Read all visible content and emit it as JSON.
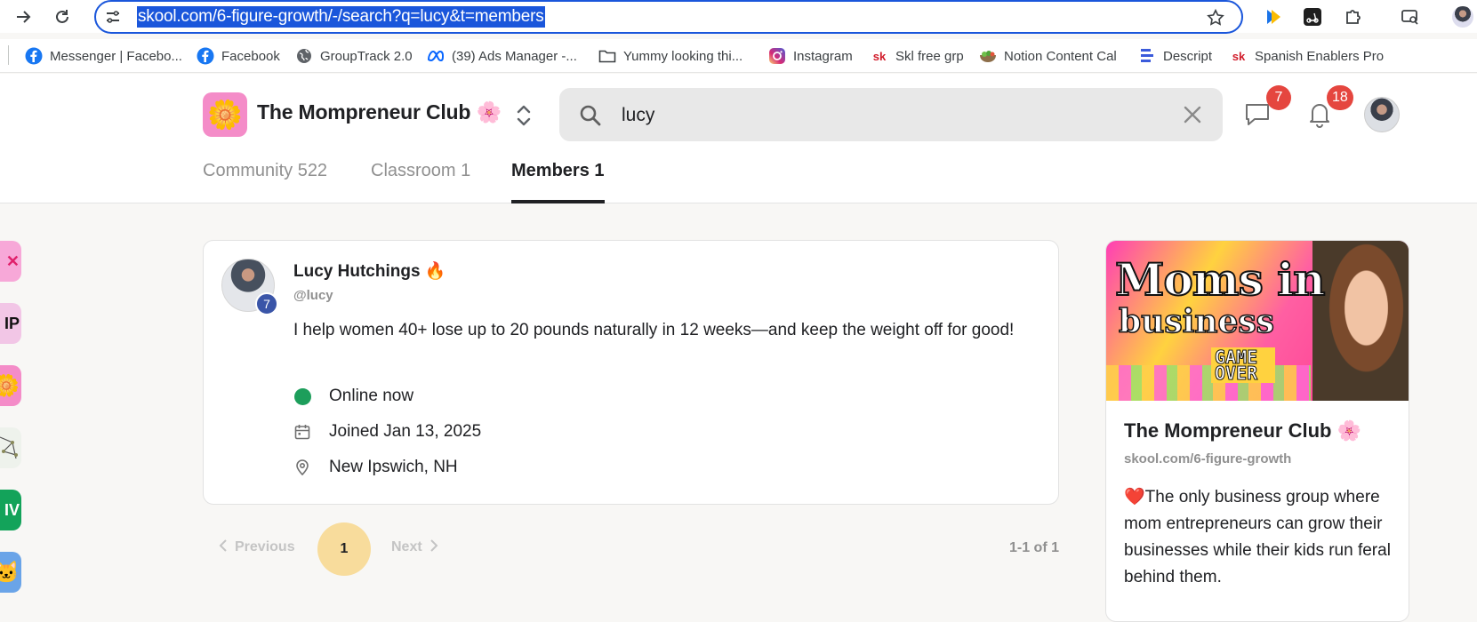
{
  "browser": {
    "url": "skool.com/6-figure-growth/-/search?q=lucy&t=members",
    "bookmarks": [
      {
        "label": "Messenger | Facebo...",
        "icon": "facebook-icon"
      },
      {
        "label": "Facebook",
        "icon": "facebook-icon"
      },
      {
        "label": "GroupTrack 2.0",
        "icon": "globe-icon"
      },
      {
        "label": "(39) Ads Manager -...",
        "icon": "meta-icon"
      },
      {
        "label": "Yummy looking thi...",
        "icon": "folder-icon"
      },
      {
        "label": "Instagram",
        "icon": "instagram-icon"
      },
      {
        "label": "Skl free grp",
        "icon": "skool-icon"
      },
      {
        "label": "Notion Content Cal",
        "icon": "salad-icon"
      },
      {
        "label": "Descript",
        "icon": "descript-icon"
      },
      {
        "label": "Spanish Enablers Pro",
        "icon": "skool-icon"
      }
    ],
    "skool_icon_text": "sk"
  },
  "header": {
    "group_name": "The Mompreneur Club 🌸",
    "logo_emoji": "🌼",
    "search_value": "lucy",
    "chat_badge": "7",
    "notif_badge": "18"
  },
  "tabs": [
    {
      "label": "Community 522",
      "active": false
    },
    {
      "label": "Classroom 1",
      "active": false
    },
    {
      "label": "Members 1",
      "active": true
    }
  ],
  "rail": [
    {
      "text": "✕",
      "color": "#f7a8d8",
      "fg": "#e0206b"
    },
    {
      "text": "IP",
      "color": "#f2c6e6",
      "fg": "#111111"
    },
    {
      "text": "🌼",
      "color": "#f48cc8",
      "fg": "#ffffff"
    },
    {
      "text": "",
      "color": "#eef2ec",
      "fg": "#333333"
    },
    {
      "text": "IV",
      "color": "#13a35a",
      "fg": "#ffffff"
    },
    {
      "text": "🐱",
      "color": "#6aa4e8",
      "fg": "#5a3a12"
    }
  ],
  "member": {
    "name": "Lucy Hutchings 🔥",
    "handle": "@lucy",
    "level": "7",
    "bio": "I help women 40+ lose up to 20 pounds naturally in 12 weeks—and keep the weight off for good!",
    "status": "Online now",
    "joined": "Joined Jan 13, 2025",
    "location": "New Ipswich, NH"
  },
  "pagination": {
    "previous": "Previous",
    "current": "1",
    "next": "Next",
    "count": "1-1 of 1"
  },
  "group_card": {
    "banner_line1": "Moms in",
    "banner_line2": "business",
    "banner_game_over": "GAME OVER",
    "title": "The Mompreneur Club 🌸",
    "url": "skool.com/6-figure-growth",
    "heart": "❤️",
    "description": "The only business group where mom entrepreneurs can grow their businesses while their kids run feral behind them."
  },
  "colors": {
    "accent_blue": "#1a56db",
    "badge_red": "#e5463f",
    "online_green": "#1d9e5b",
    "page_highlight": "#f8dc9c",
    "level_blue": "#3a55a8"
  }
}
